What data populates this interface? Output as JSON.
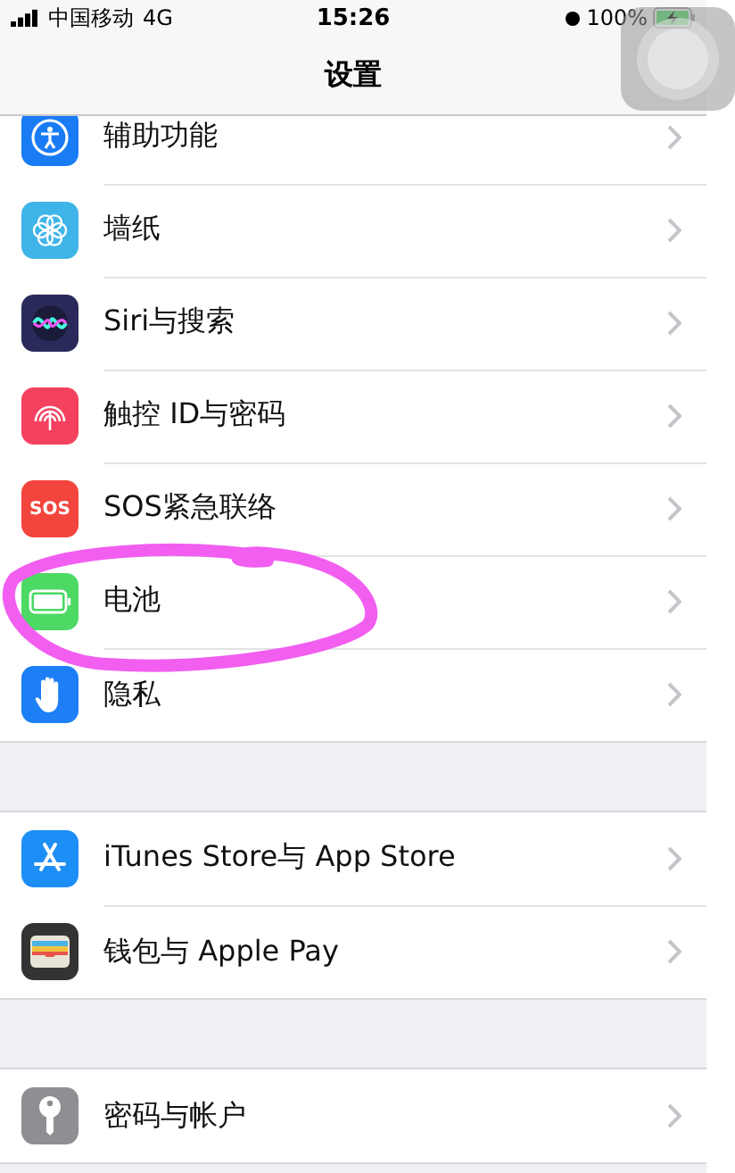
{
  "status_bar": {
    "carrier": "中国移动",
    "network": "4G",
    "time": "15:26",
    "battery": "100%",
    "charging": true,
    "alarm": true
  },
  "nav_bar": {
    "title": "设置"
  },
  "groups": [
    {
      "items": [
        {
          "label": "辅助功能",
          "kind": "accessibility"
        },
        {
          "label": "墙纸",
          "kind": "wallpaper"
        },
        {
          "label": "Siri与搜索",
          "kind": "siri"
        },
        {
          "label": "触控 ID与密码",
          "kind": "fingerprint"
        },
        {
          "label": "SOS紧急联络",
          "kind": "sos",
          "icon_text": "SOS"
        },
        {
          "label": "电池",
          "kind": "battery"
        },
        {
          "label": "隐私",
          "kind": "privacy"
        }
      ]
    },
    {
      "items": [
        {
          "label": "iTunes Store与 App Store",
          "kind": "appstore"
        },
        {
          "label": "钱包与 Apple Pay",
          "kind": "wallet"
        }
      ]
    },
    {
      "items": [
        {
          "label": "密码与帐户",
          "kind": "key"
        }
      ]
    }
  ],
  "annotation": {
    "kind": "ellipse",
    "color": "#f25ef0"
  }
}
